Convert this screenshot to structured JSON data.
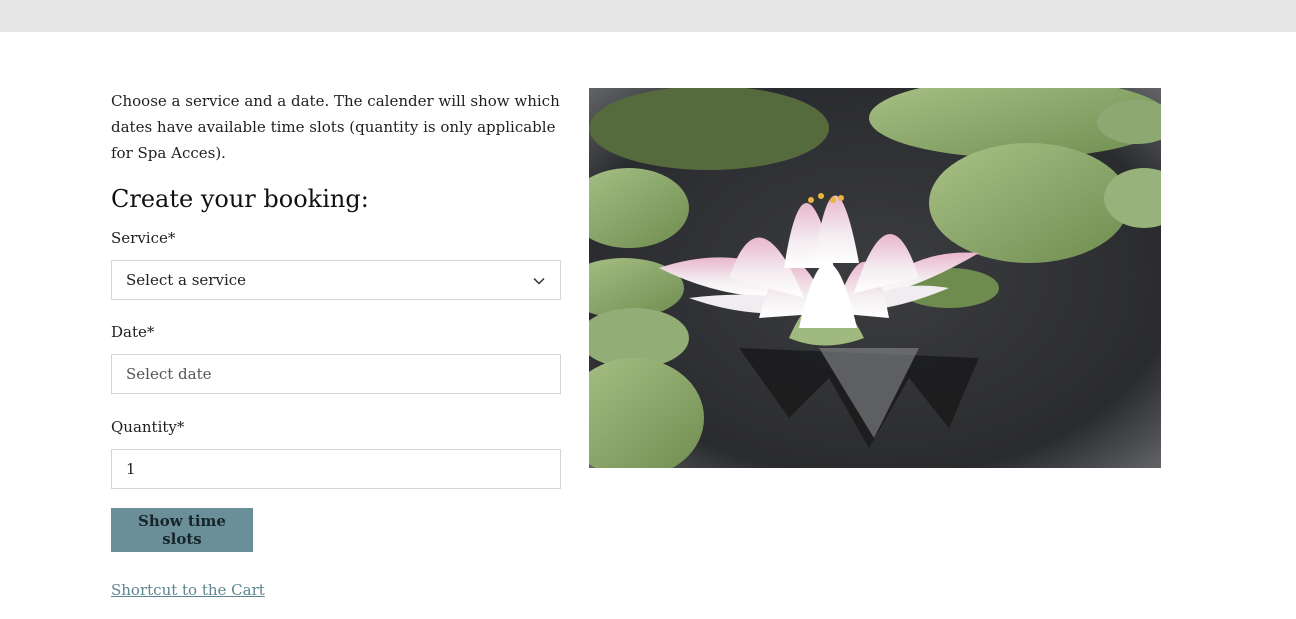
{
  "intro_text": "Choose a service and a date. The calender will show which dates have available time slots (quantity is only applicable for Spa Acces).",
  "heading": "Create your booking:",
  "service": {
    "label": "Service*",
    "value": "Select a service"
  },
  "date": {
    "label": "Date*",
    "placeholder": "Select date"
  },
  "quantity": {
    "label": "Quantity*",
    "value": "1"
  },
  "show_button_label": "Show time slots",
  "cart_link_label": "Shortcut to the Cart",
  "colors": {
    "accent_button": "#6a8f98",
    "link": "#5d8590",
    "top_bar": "#e6e6e6"
  },
  "icons": {
    "service_dropdown": "chevron-down-icon"
  }
}
